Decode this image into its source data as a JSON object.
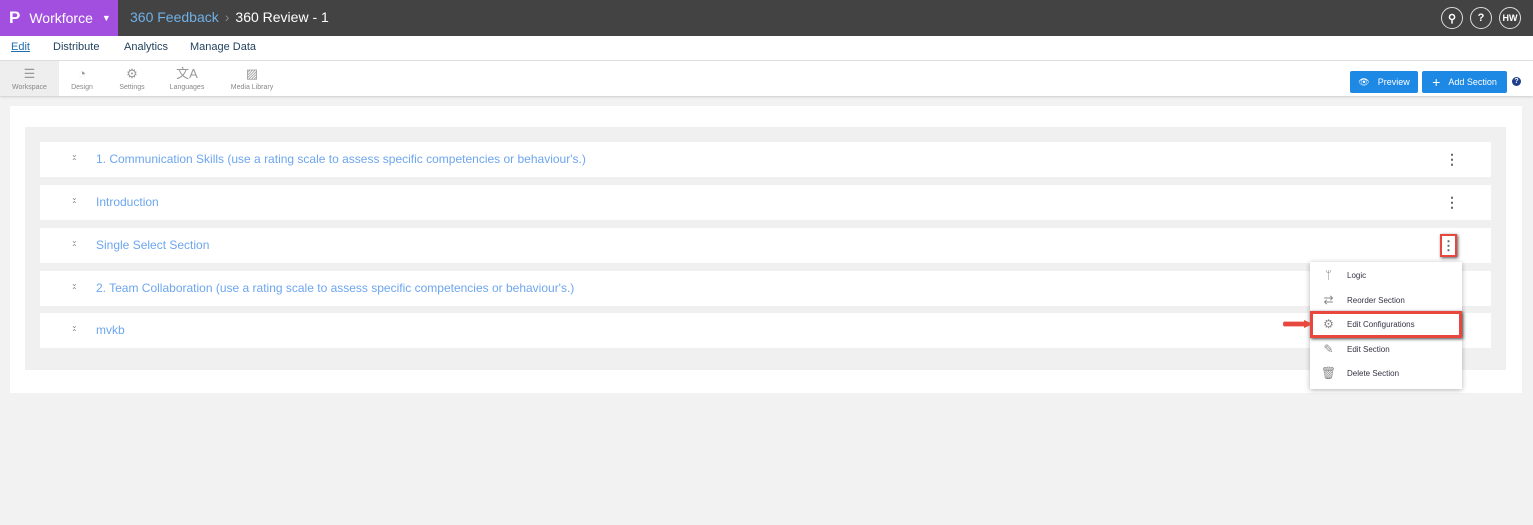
{
  "header": {
    "brand": "Workforce",
    "breadcrumb": [
      "360 Feedback",
      "360 Review - 1"
    ],
    "user_initials": "HW",
    "search_icon": "search-icon",
    "help_icon": "?"
  },
  "nav": [
    "Edit",
    "Distribute",
    "Analytics",
    "Manage Data"
  ],
  "toolbar": {
    "tools": [
      "Workspace",
      "Design",
      "Settings",
      "Languages",
      "Media Library"
    ],
    "preview": "Preview",
    "add_section": "Add Section",
    "help": "?"
  },
  "sections": [
    "1. Communication Skills (use a rating scale to assess specific competencies or behaviour's.)",
    "Introduction",
    "Single Select Section",
    "2. Team Collaboration (use a rating scale to assess specific competencies or behaviour's.)",
    "mvkb"
  ],
  "menu": [
    "Logic",
    "Reorder Section",
    "Edit Configurations",
    "Edit Section",
    "Delete Section"
  ]
}
